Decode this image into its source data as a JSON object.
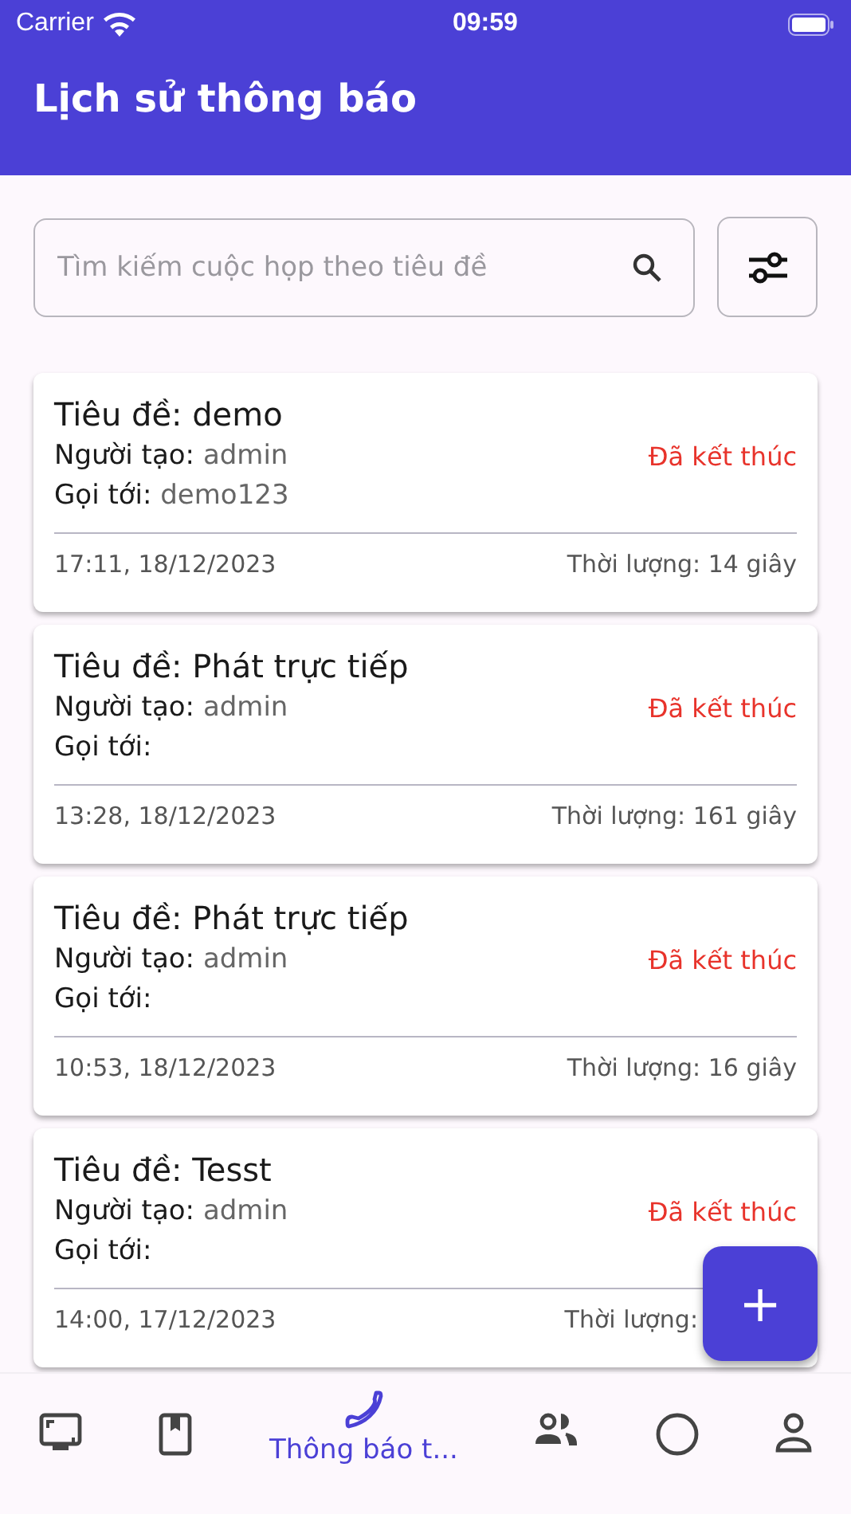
{
  "status_bar": {
    "carrier": "Carrier",
    "time": "09:59"
  },
  "header": {
    "title": "Lịch sử thông báo"
  },
  "search": {
    "placeholder": "Tìm kiếm cuộc họp theo tiêu đề"
  },
  "cards": [
    {
      "title": "Tiêu đề: demo",
      "creator_label": "Người tạo:",
      "creator": "admin",
      "callee_label": "Gọi tới:",
      "callee": "demo123",
      "status": "Đã kết thúc",
      "time": "17:11, 18/12/2023",
      "duration": "Thời lượng: 14 giây"
    },
    {
      "title": "Tiêu đề: Phát trực tiếp",
      "creator_label": "Người tạo:",
      "creator": "admin",
      "callee_label": "Gọi tới:",
      "status": "Đã kết thúc",
      "time": "13:28, 18/12/2023",
      "duration": "Thời lượng: 161 giây"
    },
    {
      "title": "Tiêu đề: Phát trực tiếp",
      "creator_label": "Người tạo:",
      "creator": "admin",
      "callee_label": "Gọi tới:",
      "status": "Đã kết thúc",
      "time": "10:53, 18/12/2023",
      "duration": "Thời lượng: 16 giây"
    },
    {
      "title": "Tiêu đề: Tesst",
      "creator_label": "Người tạo:",
      "creator": "admin",
      "callee_label": "Gọi tới:",
      "status": "Đã kết thúc",
      "time": "14:00, 17/12/2023",
      "duration": "Thời lượng:"
    }
  ],
  "fab": {
    "label": "+"
  },
  "nav": [
    {
      "kind": "screen",
      "selected": false
    },
    {
      "kind": "book",
      "selected": false
    },
    {
      "kind": "phone",
      "selected": true,
      "label": "Thông báo t..."
    },
    {
      "kind": "people",
      "selected": false
    },
    {
      "kind": "circle",
      "selected": false
    },
    {
      "kind": "person",
      "selected": false
    }
  ]
}
